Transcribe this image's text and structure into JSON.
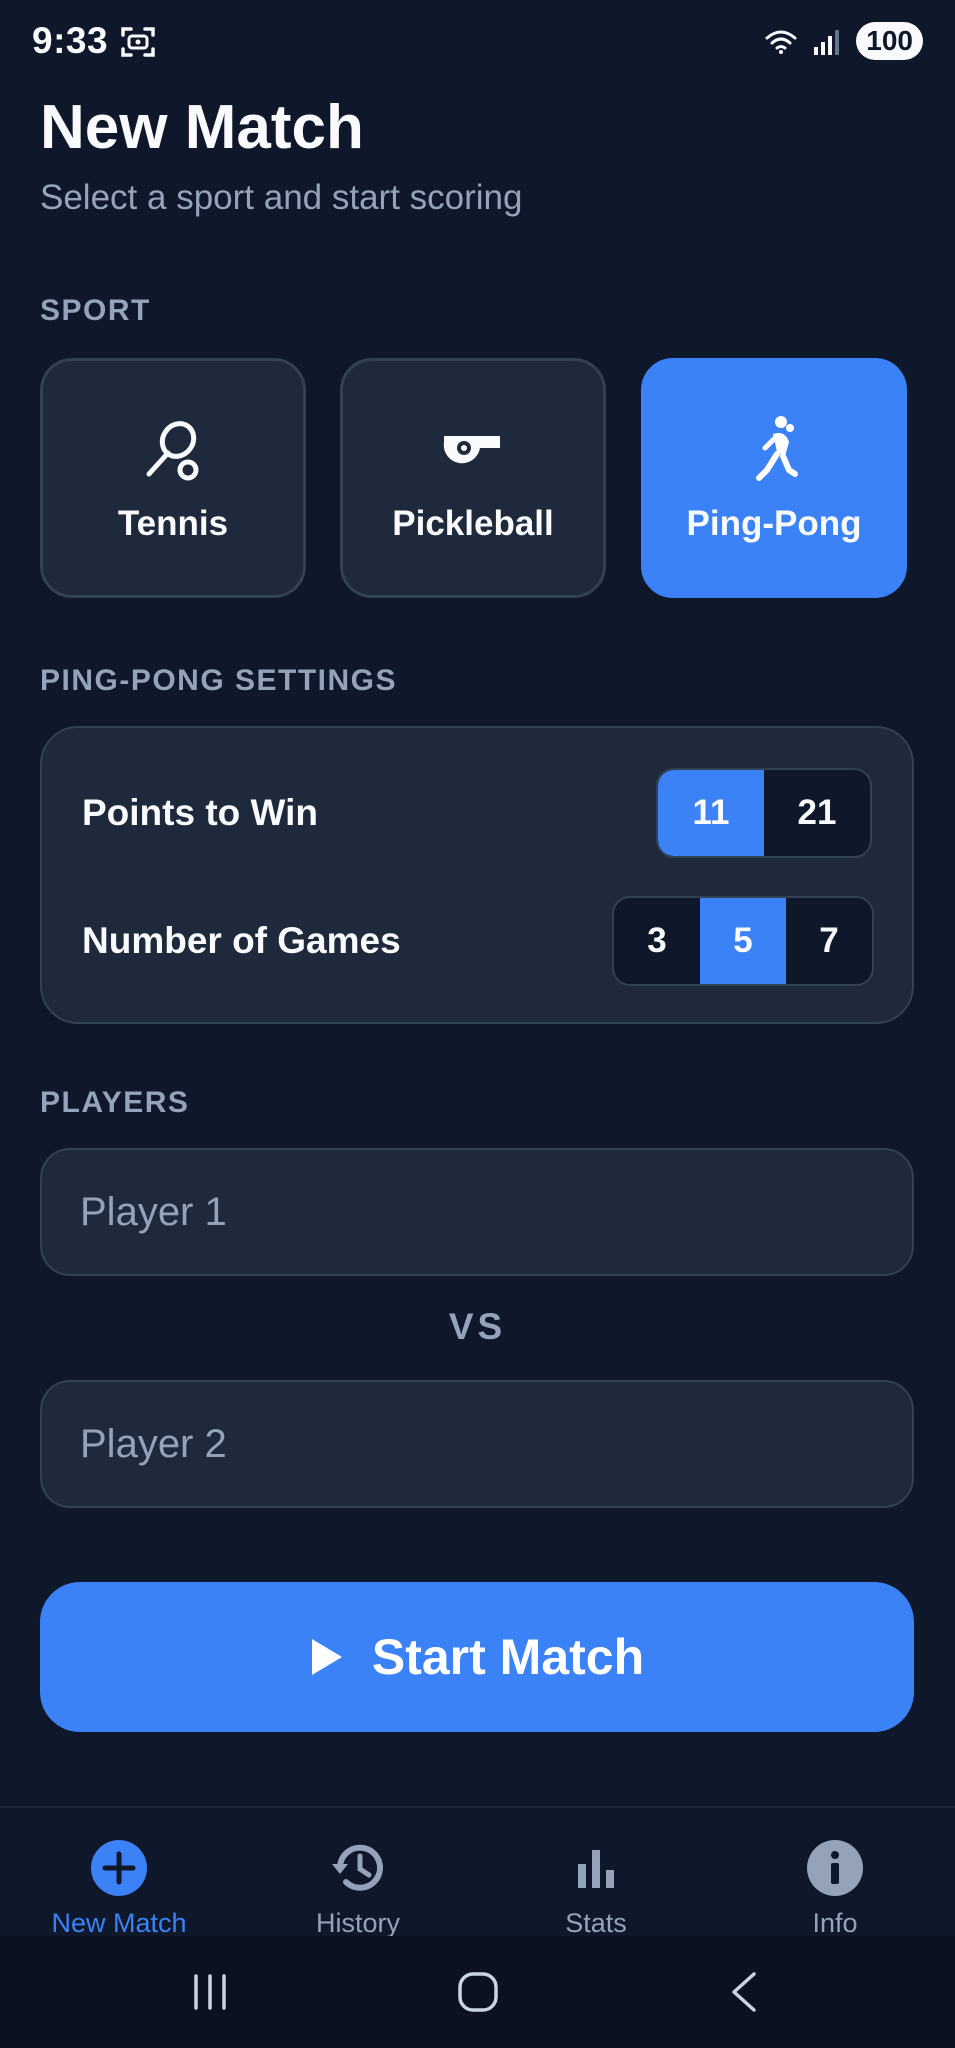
{
  "status_bar": {
    "time": "9:33",
    "battery": "100"
  },
  "header": {
    "title": "New Match",
    "subtitle": "Select a sport and start scoring"
  },
  "sport_section": {
    "label": "SPORT",
    "options": [
      {
        "label": "Tennis",
        "icon": "tennis-racket-icon",
        "selected": false
      },
      {
        "label": "Pickleball",
        "icon": "whistle-icon",
        "selected": false
      },
      {
        "label": "Ping-Pong",
        "icon": "player-icon",
        "selected": true
      }
    ]
  },
  "settings": {
    "label": "PING-PONG SETTINGS",
    "points_to_win": {
      "label": "Points to Win",
      "options": [
        "11",
        "21"
      ],
      "selected": "11"
    },
    "number_of_games": {
      "label": "Number of Games",
      "options": [
        "3",
        "5",
        "7"
      ],
      "selected": "5"
    }
  },
  "players": {
    "label": "PLAYERS",
    "player1_placeholder": "Player 1",
    "player2_placeholder": "Player 2",
    "vs": "VS"
  },
  "start_button": {
    "label": "Start Match",
    "icon": "play-icon"
  },
  "bottom_nav": {
    "items": [
      {
        "label": "New Match",
        "icon": "add-circle-icon",
        "active": true
      },
      {
        "label": "History",
        "icon": "history-icon",
        "active": false
      },
      {
        "label": "Stats",
        "icon": "bar-chart-icon",
        "active": false
      },
      {
        "label": "Info",
        "icon": "info-icon",
        "active": false
      }
    ]
  },
  "colors": {
    "background": "#0f172a",
    "card": "#1e293b",
    "accent": "#3b82f6",
    "muted": "#94a3b8"
  }
}
